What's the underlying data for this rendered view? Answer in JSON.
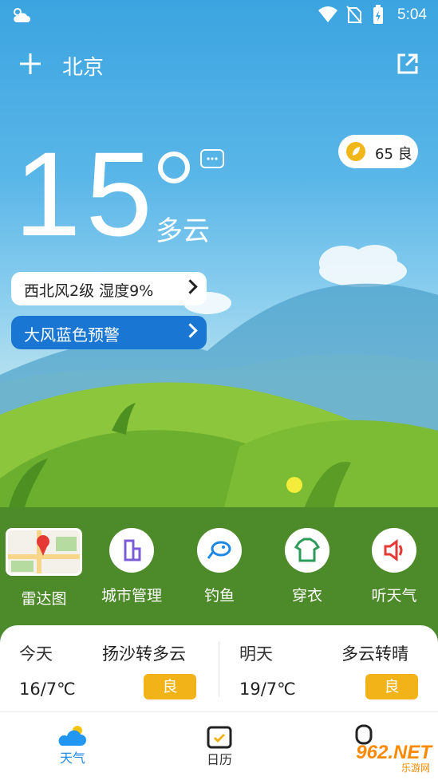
{
  "status_bar": {
    "time": "5:04"
  },
  "header": {
    "city": "北京"
  },
  "weather": {
    "temperature": "15",
    "condition": "多云",
    "aqi_value": "65",
    "aqi_level": "良"
  },
  "wind_pill": {
    "label": "西北风2级  湿度9%"
  },
  "warning_pill": {
    "label": "大风蓝色预警"
  },
  "tools": [
    {
      "label": "雷达图"
    },
    {
      "label": "城市管理"
    },
    {
      "label": "钓鱼"
    },
    {
      "label": "穿衣"
    },
    {
      "label": "听天气"
    }
  ],
  "forecast": {
    "today": {
      "day": "今天",
      "condition": "扬沙转多云",
      "temp": "16/7℃",
      "aqi": "良"
    },
    "tomorrow": {
      "day": "明天",
      "condition": "多云转晴",
      "temp": "19/7℃",
      "aqi": "良"
    }
  },
  "nav": [
    {
      "label": "天气"
    },
    {
      "label": "日历"
    }
  ],
  "watermark": {
    "brand": "962.NET",
    "sub": "乐游网"
  },
  "colors": {
    "sky": "#3ba4e0",
    "grass": "#4d8a2a",
    "accent_blue": "#1976d2",
    "badge_yellow": "#f2b318"
  }
}
